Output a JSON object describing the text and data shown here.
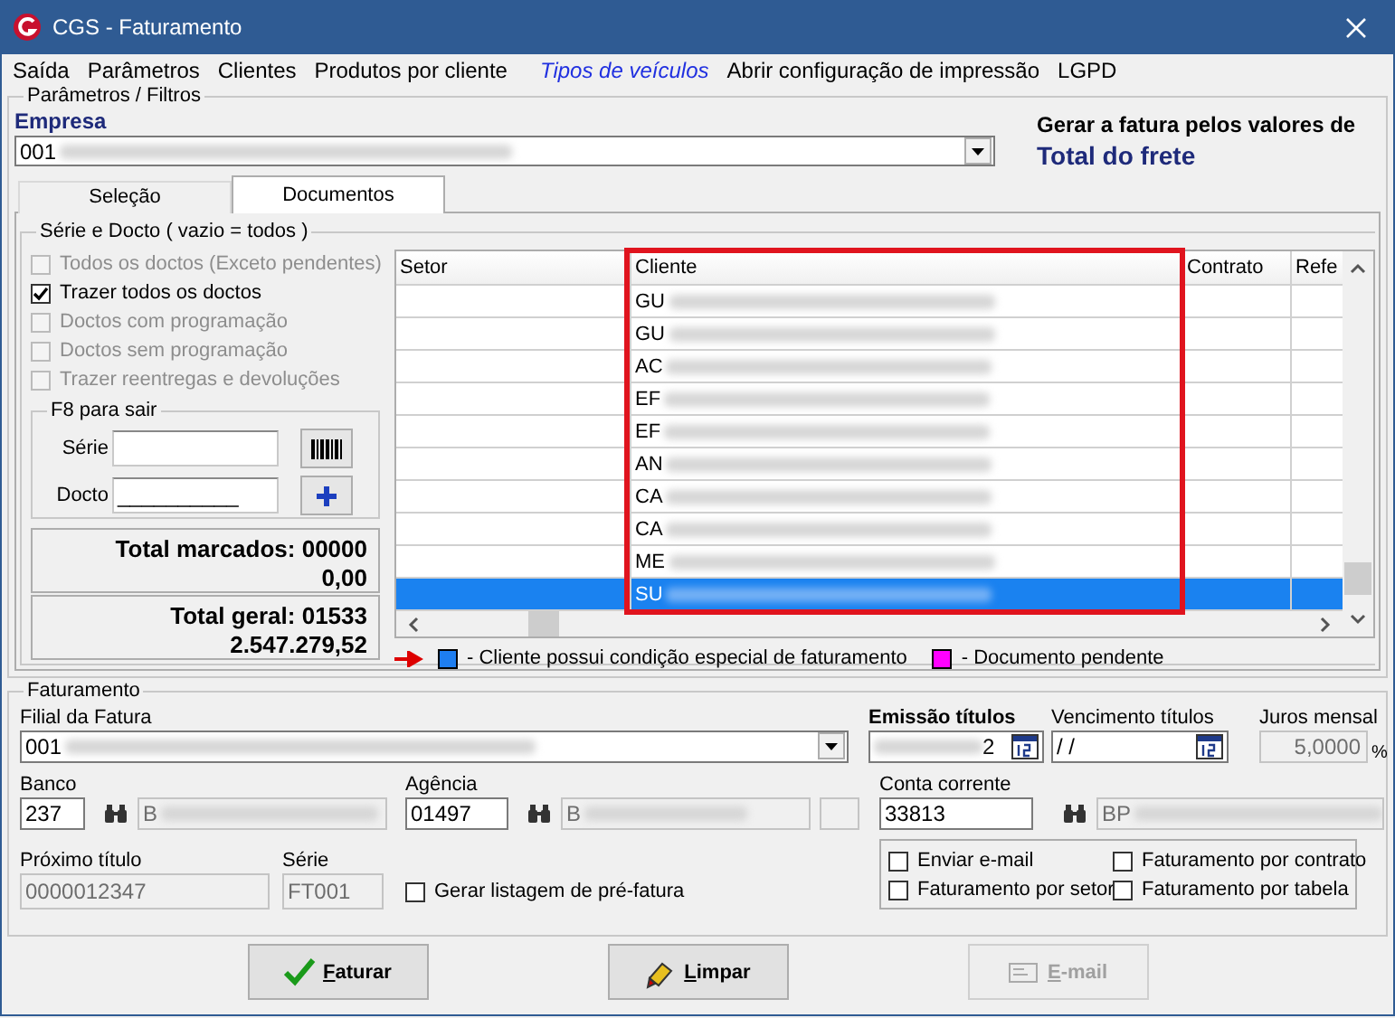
{
  "window": {
    "title": "CGS - Faturamento"
  },
  "menu": [
    {
      "label": "Saída",
      "highlighted": false
    },
    {
      "label": "Parâmetros",
      "highlighted": false
    },
    {
      "label": "Clientes",
      "highlighted": false
    },
    {
      "label": "Produtos por cliente",
      "highlighted": false
    },
    {
      "label": "Tipos de veículos",
      "highlighted": true
    },
    {
      "label": "Abrir configuração de impressão",
      "highlighted": false
    },
    {
      "label": "LGPD",
      "highlighted": false
    }
  ],
  "filters": {
    "group_title": "Parâmetros / Filtros",
    "company_label": "Empresa",
    "company_value": "001",
    "invoice_basis_label": "Gerar a fatura pelos valores de",
    "invoice_basis_value": "Total do frete"
  },
  "tabs": [
    {
      "label": "Seleção",
      "selected": false
    },
    {
      "label": "Documentos",
      "selected": true
    }
  ],
  "series_group": {
    "title": "Série e Docto  ( vazio = todos )",
    "options": [
      {
        "label": "Todos os doctos (Exceto pendentes)",
        "checked": false,
        "disabled": true
      },
      {
        "label": "Trazer todos os doctos",
        "checked": true,
        "disabled": false
      },
      {
        "label": "Doctos com programação",
        "checked": false,
        "disabled": true
      },
      {
        "label": "Doctos sem programação",
        "checked": false,
        "disabled": true
      },
      {
        "label": "Trazer reentregas e devoluções",
        "checked": false,
        "disabled": true
      }
    ]
  },
  "exit_group": {
    "title": "F8 para sair",
    "serie_label": "Série",
    "docto_label": "Docto",
    "docto_value": "__________"
  },
  "totals": [
    {
      "label": "Total marcados: 00000",
      "amount": "0,00"
    },
    {
      "label": "Total geral: 01533",
      "amount": "2.547.279,52"
    }
  ],
  "grid": {
    "columns": [
      "Setor",
      "Cliente",
      "Contrato",
      "Refe"
    ],
    "rows": [
      {
        "cliente": "GU",
        "selected": false
      },
      {
        "cliente": "GU",
        "selected": false
      },
      {
        "cliente": "AC",
        "selected": false
      },
      {
        "cliente": "EF",
        "selected": false
      },
      {
        "cliente": "EF",
        "selected": false
      },
      {
        "cliente": "AN",
        "selected": false
      },
      {
        "cliente": "CA",
        "selected": false
      },
      {
        "cliente": "CA",
        "selected": false
      },
      {
        "cliente": "ME",
        "selected": false
      },
      {
        "cliente": "SU",
        "selected": true
      }
    ]
  },
  "legend": [
    {
      "color": "#1e7ef0",
      "text": "- Cliente possui condição especial de faturamento"
    },
    {
      "color": "#ff00ff",
      "text": "- Documento pendente"
    }
  ],
  "billing": {
    "group_title": "Faturamento",
    "branch_label": "Filial da Fatura",
    "branch_value": "001",
    "issue_label": "Emissão títulos",
    "issue_value": "2",
    "due_label": "Vencimento títulos",
    "due_value": " / /",
    "interest_label": "Juros mensal",
    "interest_value": "5,0000",
    "interest_unit": "%",
    "bank_label": "Banco",
    "bank_value": "237",
    "bank_name": "B",
    "agency_label": "Agência",
    "agency_value": "01497",
    "agency_name": "B",
    "account_label": "Conta corrente",
    "account_value": "33813",
    "account_name": "BP",
    "next_label": "Próximo título",
    "next_value": "0000012347",
    "series_label": "Série",
    "series_value": "FT001",
    "prelist": {
      "label": "Gerar listagem de pré-fatura",
      "checked": false
    },
    "options": [
      {
        "label": "Enviar e-mail",
        "checked": false
      },
      {
        "label": "Faturamento por contrato",
        "checked": false
      },
      {
        "label": "Faturamento por setor",
        "checked": false
      },
      {
        "label": "Faturamento por tabela",
        "checked": false
      }
    ]
  },
  "buttons": [
    {
      "label": "Faturar",
      "kind": "confirm",
      "disabled": false
    },
    {
      "label": "Limpar",
      "kind": "clear",
      "disabled": false
    },
    {
      "label": "E-mail",
      "kind": "email",
      "disabled": true
    }
  ]
}
